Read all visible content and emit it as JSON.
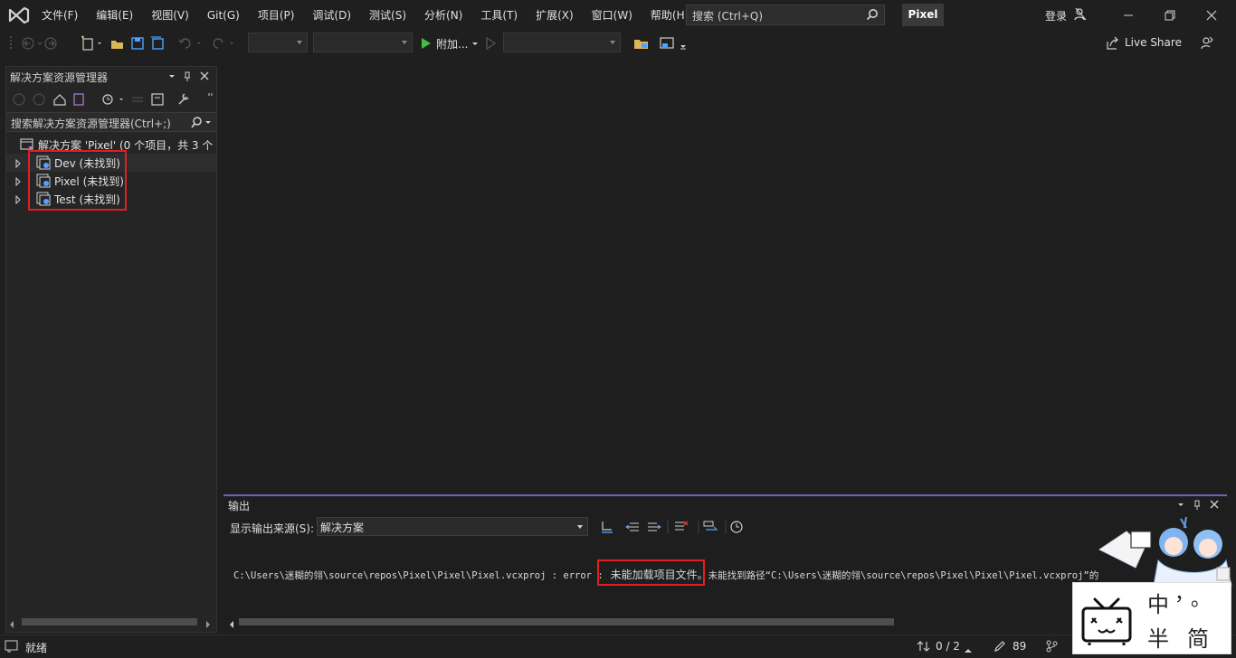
{
  "titlebar": {
    "menu": [
      "文件(F)",
      "编辑(E)",
      "视图(V)",
      "Git(G)",
      "项目(P)",
      "调试(D)",
      "测试(S)",
      "分析(N)",
      "工具(T)",
      "扩展(X)",
      "窗口(W)",
      "帮助(H)"
    ],
    "search_placeholder": "搜索 (Ctrl+Q)",
    "solution_name": "Pixel",
    "signin": "登录"
  },
  "toolbar": {
    "attach_label": "附加...",
    "live_share": "Live Share"
  },
  "solution_explorer": {
    "title": "解决方案资源管理器",
    "search_placeholder": "搜索解决方案资源管理器(Ctrl+;)",
    "root": "解决方案 'Pixel' (0 个项目，共 3 个",
    "projects": [
      {
        "label": "Dev (未找到)"
      },
      {
        "label": "Pixel (未找到)"
      },
      {
        "label": "Test (未找到)"
      }
    ]
  },
  "output": {
    "title": "输出",
    "source_label": "显示输出来源(S):",
    "source_value": "解决方案",
    "line_prefix": "C:\\Users\\迷糊的翎\\source\\repos\\Pixel\\Pixel\\Pixel.vcxproj : error  :",
    "line_highlight": "未能加载项目文件。",
    "line_suffix": "未能找到路径“C:\\Users\\迷糊的翎\\source\\repos\\Pixel\\Pixel\\Pixel.vcxproj”的"
  },
  "statusbar": {
    "ready": "就绪",
    "sync": "0 / 2",
    "edits": "89"
  },
  "watermark": {
    "chars": [
      "中",
      "，",
      "。",
      "半",
      "简"
    ]
  },
  "colors": {
    "accent": "#6f5fb8",
    "highlight_box": "#e02020",
    "run_green": "#3fbf3f"
  }
}
